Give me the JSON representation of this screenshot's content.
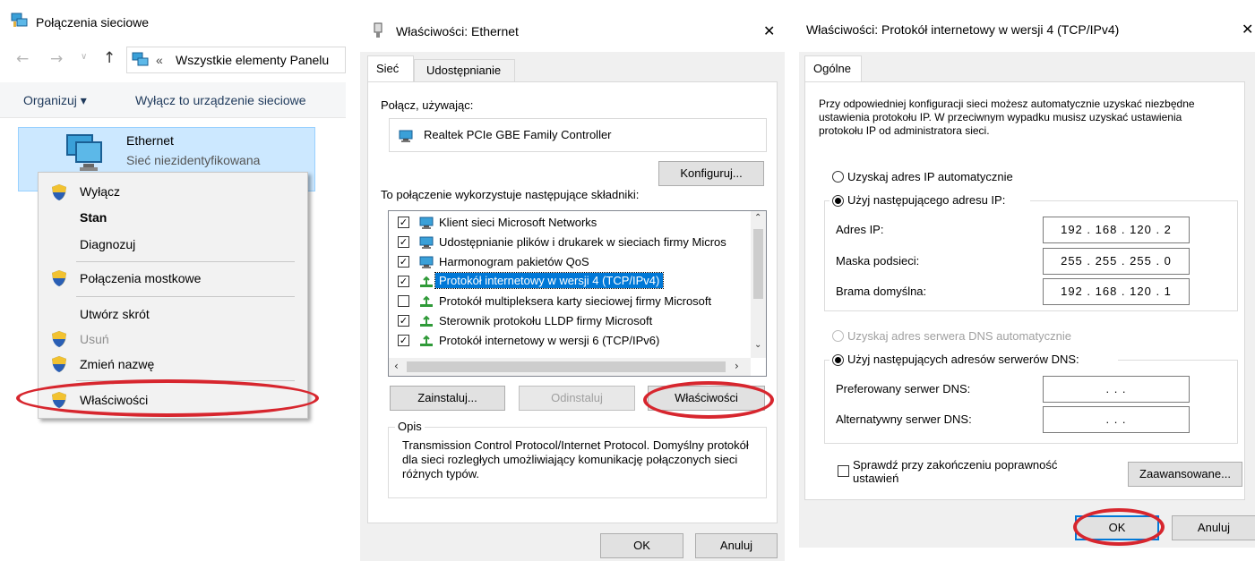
{
  "win1": {
    "title": "Połączenia sieciowe",
    "address": "Wszystkie elementy Panelu",
    "address_prefix": "«",
    "toolbar": {
      "organize": "Organizuj ▾",
      "disable": "Wyłącz to urządzenie sieciowe"
    },
    "adapter": {
      "name": "Ethernet",
      "status": "Sieć niezidentyfikowana"
    },
    "menu": [
      {
        "label": "Wyłącz",
        "icon": "shield-icon"
      },
      {
        "label": "Stan"
      },
      {
        "label": "Diagnozuj"
      },
      {
        "label": "Połączenia mostkowe",
        "icon": "shield-icon"
      },
      {
        "label": "Utwórz skrót"
      },
      {
        "label": "Usuń",
        "icon": "shield-icon",
        "disabled": true
      },
      {
        "label": "Zmień nazwę",
        "icon": "shield-icon"
      },
      {
        "label": "Właściwości",
        "icon": "shield-icon"
      }
    ]
  },
  "win2": {
    "title": "Właściwości: Ethernet",
    "close": "✕",
    "tabs": [
      "Sieć",
      "Udostępnianie"
    ],
    "connect_using": "Połącz, używając:",
    "adapter": "Realtek PCIe GBE Family Controller",
    "configure": "Konfiguruj...",
    "components_label": "To połączenie wykorzystuje następujące składniki:",
    "components": [
      {
        "label": "Klient sieci Microsoft Networks",
        "checked": true
      },
      {
        "label": "Udostępnianie plików i drukarek w sieciach firmy Micros",
        "checked": true
      },
      {
        "label": "Harmonogram pakietów QoS",
        "checked": true
      },
      {
        "label": "Protokół internetowy w wersji 4 (TCP/IPv4)",
        "checked": true,
        "selected": true
      },
      {
        "label": "Protokół multipleksera karty sieciowej firmy Microsoft",
        "checked": false
      },
      {
        "label": "Sterownik protokołu LLDP firmy Microsoft",
        "checked": true
      },
      {
        "label": "Protokół internetowy w wersji 6 (TCP/IPv6)",
        "checked": true
      }
    ],
    "install": "Zainstaluj...",
    "uninstall": "Odinstaluj",
    "properties": "Właściwości",
    "description_title": "Opis",
    "description": "Transmission Control Protocol/Internet Protocol. Domyślny protokół dla sieci rozległych umożliwiający komunikację połączonych sieci różnych typów.",
    "ok": "OK",
    "cancel": "Anuluj"
  },
  "win3": {
    "title": "Właściwości: Protokół internetowy w wersji 4 (TCP/IPv4)",
    "close": "✕",
    "tab": "Ogólne",
    "intro": "Przy odpowiedniej konfiguracji sieci możesz automatycznie uzyskać niezbędne ustawienia protokołu IP. W przeciwnym wypadku musisz uzyskać ustawienia protokołu IP od administratora sieci.",
    "ip_auto": "Uzyskaj adres IP automatycznie",
    "ip_manual": "Użyj następującego adresu IP:",
    "ip_label": "Adres IP:",
    "ip_value": "192 . 168 . 120 . 2",
    "mask_label": "Maska podsieci:",
    "mask_value": "255 . 255 . 255 . 0",
    "gateway_label": "Brama domyślna:",
    "gateway_value": "192 . 168 . 120 . 1",
    "dns_auto": "Uzyskaj adres serwera DNS automatycznie",
    "dns_manual": "Użyj następujących adresów serwerów DNS:",
    "dns_pref_label": "Preferowany serwer DNS:",
    "dns_pref_value": ".     .     .",
    "dns_alt_label": "Alternatywny serwer DNS:",
    "dns_alt_value": ".     .     .",
    "validate": "Sprawdź przy zakończeniu poprawność ustawień",
    "advanced": "Zaawansowane...",
    "ok": "OK",
    "cancel": "Anuluj"
  }
}
